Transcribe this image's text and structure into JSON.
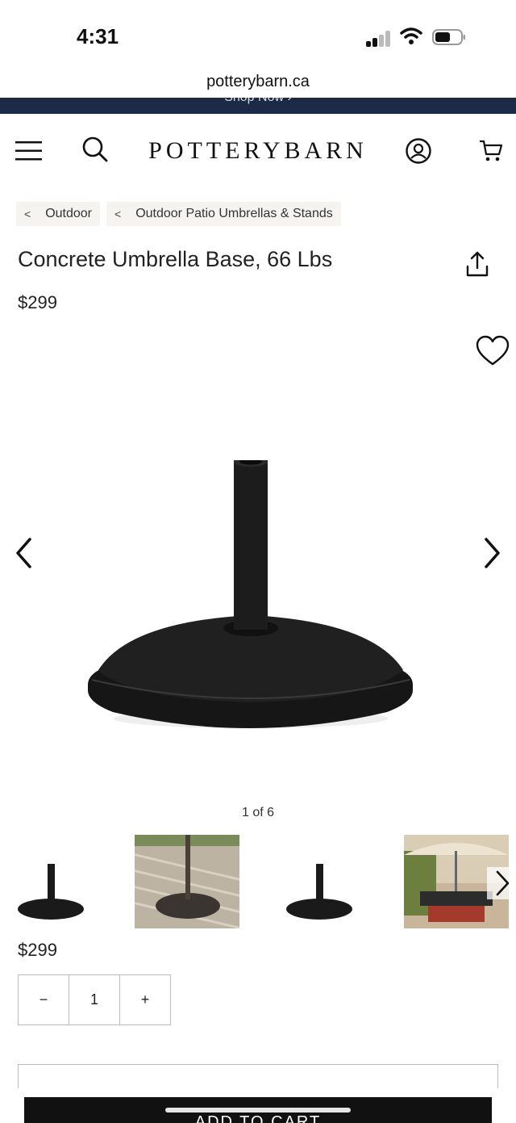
{
  "status": {
    "time": "4:31",
    "icons": [
      "cellular-signal-icon",
      "wifi-icon",
      "battery-icon"
    ]
  },
  "browser": {
    "url": "potterybarn.ca"
  },
  "promo": {
    "text": "Shop Now ›"
  },
  "header": {
    "logo": "POTTERYBARN",
    "icons": [
      "menu-icon",
      "search-icon",
      "account-icon",
      "cart-icon"
    ]
  },
  "breadcrumb": [
    {
      "sep": "<",
      "label": "Outdoor"
    },
    {
      "sep": "<",
      "label": "Outdoor Patio Umbrellas & Stands"
    }
  ],
  "product": {
    "title": "Concrete Umbrella Base, 66 Lbs",
    "price": "$299",
    "image_counter": "1 of 6"
  },
  "quantity": {
    "minus": "−",
    "value": "1",
    "plus": "+"
  },
  "cta": {
    "add_to_cart": "ADD TO CART"
  },
  "colors": {
    "promo_bg": "#1d2a47",
    "cta_bg": "#111111",
    "breadcrumb_bg": "#f6f4f1"
  }
}
